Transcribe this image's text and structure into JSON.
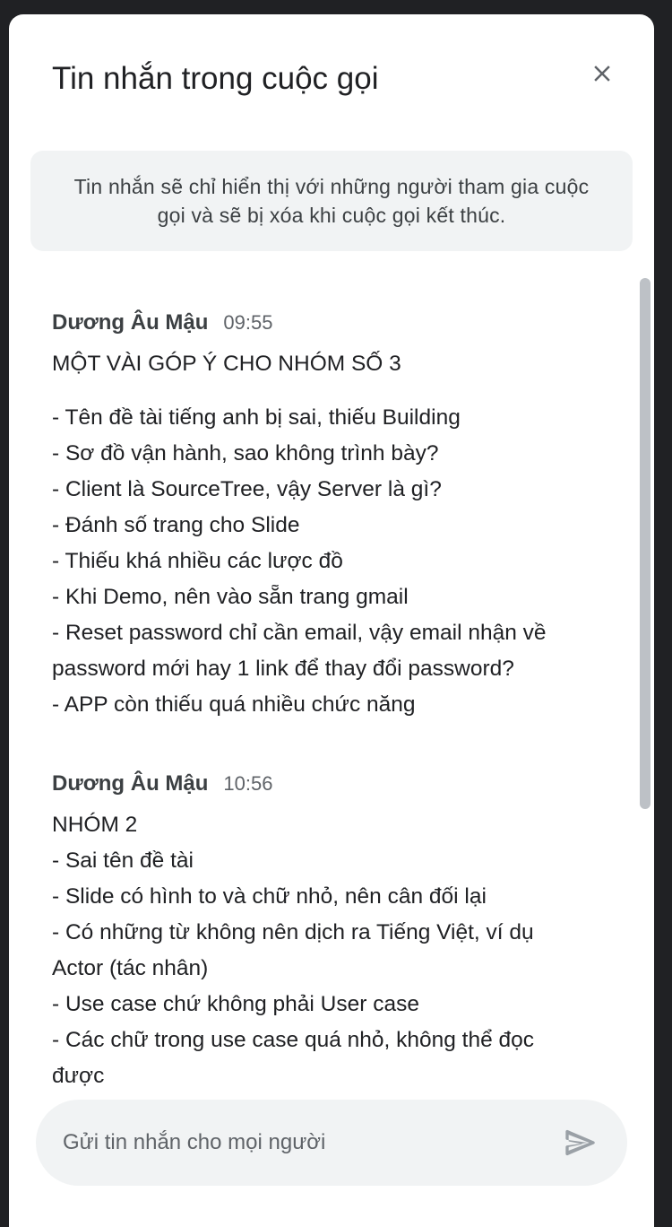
{
  "header": {
    "title": "Tin nhắn trong cuộc gọi"
  },
  "notice": {
    "text": "Tin nhắn sẽ chỉ hiển thị với những người tham gia cuộc gọi và sẽ bị xóa khi cuộc gọi kết thúc."
  },
  "messages": [
    {
      "sender": "Dương Âu Mậu",
      "time": "09:55",
      "title": "MỘT VÀI GÓP Ý CHO NHÓM SỐ 3",
      "lines": [
        "- Tên đề tài tiếng anh bị sai, thiếu Building",
        "- Sơ đồ vận hành, sao không trình bày?",
        "- Client là SourceTree, vậy Server là gì?",
        "- Đánh số trang cho Slide",
        "- Thiếu khá nhiều các lược đồ",
        "- Khi Demo, nên vào sẵn trang gmail",
        "- Reset password chỉ cần email, vậy email nhận về",
        "password mới hay 1 link để thay đổi password?",
        "- APP còn thiếu quá nhiều chức năng"
      ]
    },
    {
      "sender": "Dương Âu Mậu",
      "time": "10:56",
      "title": "NHÓM 2",
      "lines": [
        "- Sai tên đề tài",
        "- Slide có hình to và chữ nhỏ, nên cân đối lại",
        "- Có những từ không nên dịch ra Tiếng Việt, ví dụ",
        "Actor (tác nhân)",
        "- Use case chứ không phải User case",
        "- Các chữ trong use case quá nhỏ, không thể đọc",
        "được"
      ]
    }
  ],
  "composer": {
    "placeholder": "Gửi tin nhắn cho mọi người"
  },
  "icons": {
    "close": "close-icon",
    "send": "send-icon"
  },
  "colors": {
    "background": "#202124",
    "panel": "#ffffff",
    "surface": "#f1f3f4",
    "text": "#202124",
    "secondary_text": "#5f6368",
    "icon": "#5f6368",
    "send_icon": "#9aa0a6"
  }
}
